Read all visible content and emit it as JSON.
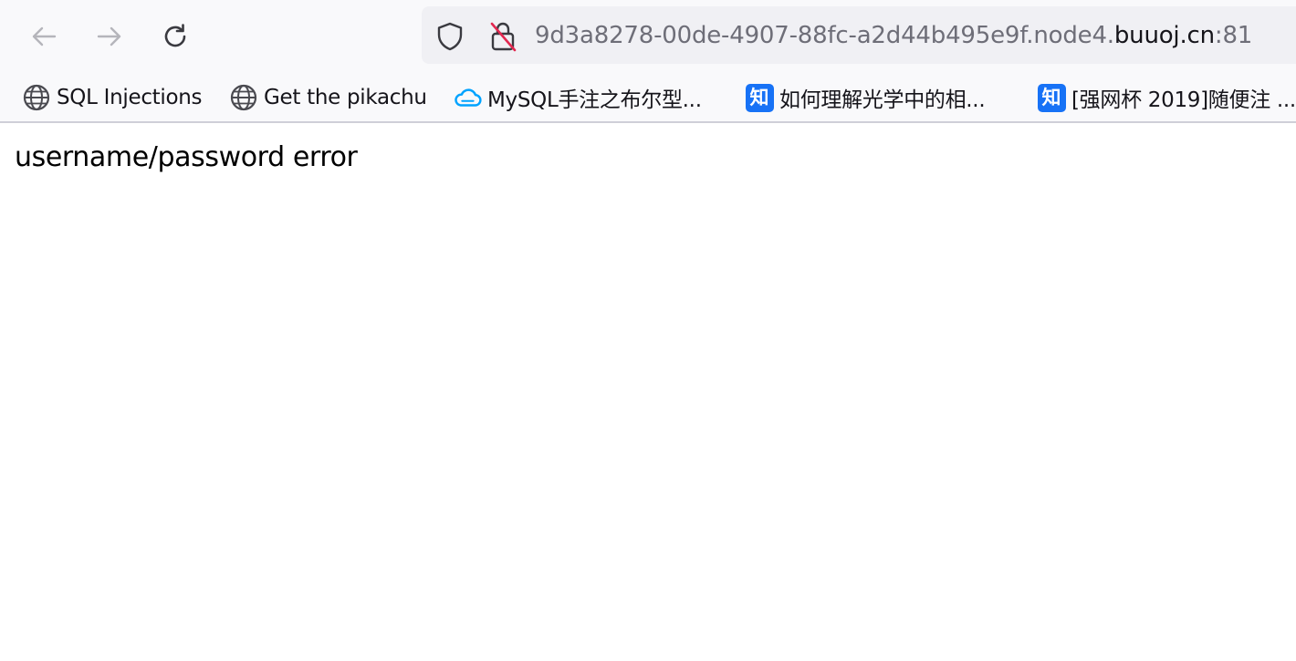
{
  "browser": {
    "url": {
      "prefix": "9d3a8278-00de-4907-88fc-a2d44b495e9f.node4.",
      "domain": "buuoj.cn",
      "port": ":81"
    },
    "icons": {
      "back": "arrow-left-icon",
      "forward": "arrow-right-icon",
      "reload": "reload-icon",
      "tracking_protection": "shield-icon",
      "insecure": "lock-crossed-icon"
    },
    "colors": {
      "chrome_bg": "#f9f9fb",
      "urlbar_bg": "#f0f0f4",
      "zhihu_blue": "#1772f6",
      "cloud_blue": "#00a3ff",
      "insecure_red": "#e22850"
    }
  },
  "bookmarks": [
    {
      "label": "SQL Injections",
      "icon": "globe-icon"
    },
    {
      "label": "Get the pikachu",
      "icon": "globe-icon"
    },
    {
      "label": "MySQL手注之布尔型...",
      "icon": "cloud-icon"
    },
    {
      "label": "如何理解光学中的相...",
      "icon": "zhihu-icon",
      "badge": "知"
    },
    {
      "label": "[强网杯 2019]随便注 ...",
      "icon": "zhihu-icon",
      "badge": "知"
    }
  ],
  "page": {
    "message": "username/password error"
  }
}
